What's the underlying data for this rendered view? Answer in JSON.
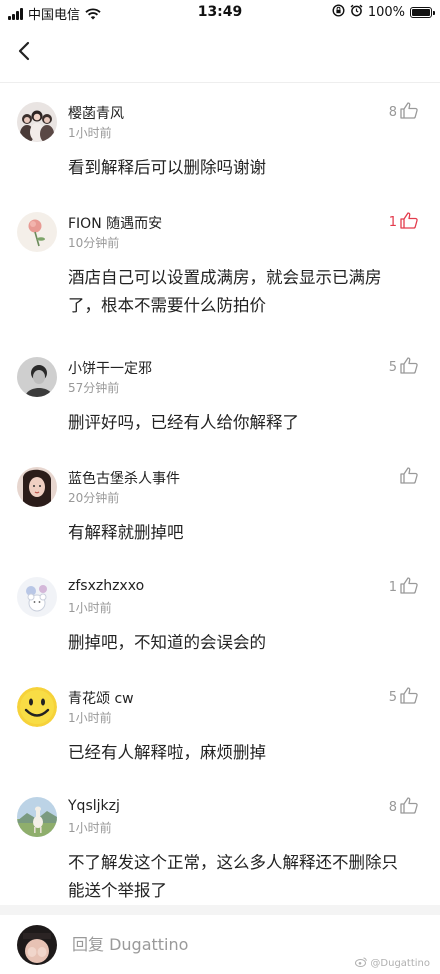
{
  "status_bar": {
    "carrier": "中国电信",
    "time": "13:49",
    "battery": "100%",
    "battery_level": 1.0
  },
  "nav": {
    "back_icon": "chevron-left-icon"
  },
  "comments": [
    {
      "username": "樱菡青风",
      "time": "1小时前",
      "text": "看到解释后可以删除吗谢谢",
      "likes": "8",
      "liked": false,
      "avatar": "three-girls-photo"
    },
    {
      "username": "FION 随遇而安",
      "time": "10分钟前",
      "text": "酒店自己可以设置成满房，就会显示已满房了，根本不需要什么防拍价",
      "likes": "1",
      "liked": true,
      "avatar": "rose-photo"
    },
    {
      "username": "小饼干一定邪",
      "time": "57分钟前",
      "text": "删评好吗，已经有人给你解释了",
      "likes": "5",
      "liked": false,
      "avatar": "boy-bw-photo"
    },
    {
      "username": "蓝色古堡杀人事件",
      "time": "20分钟前",
      "text": "有解释就删掉吧",
      "likes": "",
      "liked": false,
      "avatar": "girl-portrait"
    },
    {
      "username": "zfsxzhzxxo",
      "time": "1小时前",
      "text": "删掉吧，不知道的会误会的",
      "likes": "1",
      "liked": false,
      "avatar": "flower-bear-illustration"
    },
    {
      "username": "青花颂 cw",
      "time": "1小时前",
      "text": "已经有人解释啦，麻烦删掉",
      "likes": "5",
      "liked": false,
      "avatar": "smiley-face"
    },
    {
      "username": "Yqsljkzj",
      "time": "1小时前",
      "text": "不了解发这个正常，这么多人解释还不删除只能送个举报了",
      "likes": "8",
      "liked": false,
      "avatar": "alpaca-landscape"
    }
  ],
  "reply": {
    "placeholder": "回复 Dugattino",
    "watermark": "@Dugattino"
  },
  "colors": {
    "like_active": "#e33b4c",
    "muted": "#999999"
  }
}
